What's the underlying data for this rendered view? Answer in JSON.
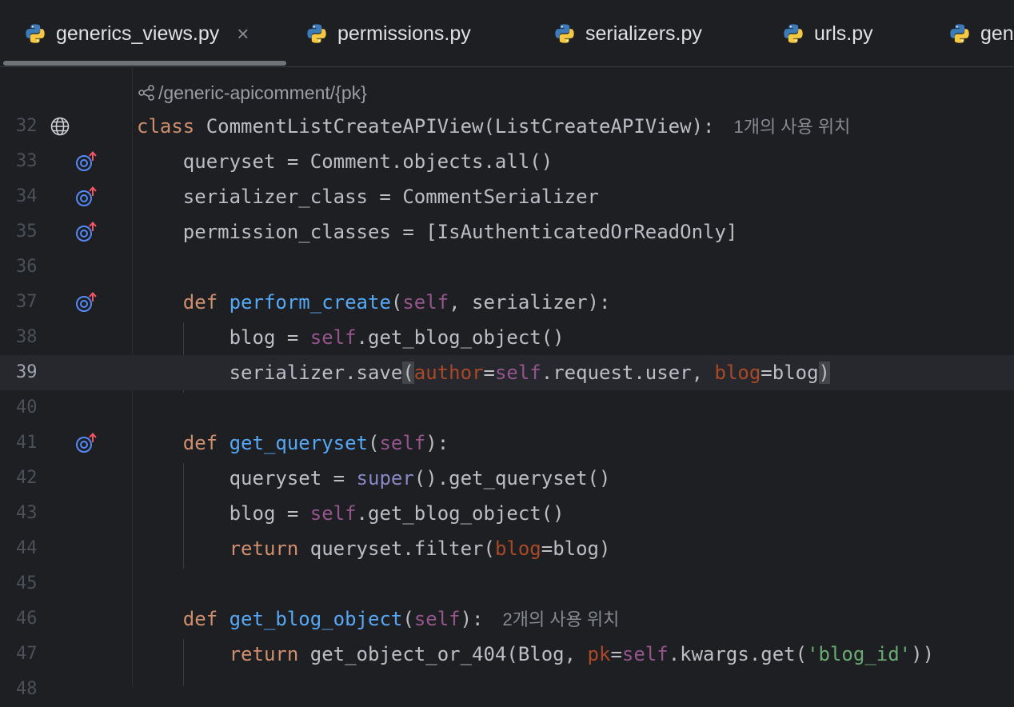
{
  "tabs": [
    {
      "label": "generics_views.py",
      "active": true,
      "closable": true
    },
    {
      "label": "permissions.py",
      "active": false
    },
    {
      "label": "serializers.py",
      "active": false
    },
    {
      "label": "urls.py",
      "active": false
    },
    {
      "label": "gen",
      "active": false
    }
  ],
  "editor": {
    "route_hint": "/generic-apicomment/{pk}",
    "current_line": 39,
    "lines": [
      {
        "num": "32"
      },
      {
        "num": "33"
      },
      {
        "num": "34"
      },
      {
        "num": "35"
      },
      {
        "num": "36"
      },
      {
        "num": "37"
      },
      {
        "num": "38"
      },
      {
        "num": "39"
      },
      {
        "num": "40"
      },
      {
        "num": "41"
      },
      {
        "num": "42"
      },
      {
        "num": "43"
      },
      {
        "num": "44"
      },
      {
        "num": "45"
      },
      {
        "num": "46"
      },
      {
        "num": "47"
      },
      {
        "num": "48"
      }
    ],
    "usage_hint_1": "1개의 사용 위치",
    "usage_hint_2": "2개의 사용 위치",
    "tokens": {
      "class_kw": "class",
      "class_name": " CommentListCreateAPIView(ListCreateAPIView):",
      "l33": "    queryset = Comment.objects.all()",
      "l34": "    serializer_class = CommentSerializer",
      "l35": "    permission_classes = [IsAuthenticatedOrReadOnly]",
      "def": "def",
      "perform_create": "perform_create",
      "get_queryset": "get_queryset",
      "get_blog_object": "get_blog_object",
      "self": "self",
      "serializer_param": ", serializer):",
      "open_paren": "(",
      "close_paren": ")",
      "close_colon": "):",
      "blog_eq": "blog = ",
      "get_blog_call": ".get_blog_object()",
      "serializer_save": "serializer.save",
      "author": "author",
      "eq": "=",
      "request_user": ".request.user, ",
      "blog_kw": "blog",
      "blog_val": "blog",
      "queryset_eq": "queryset = ",
      "super": "super",
      "super_rest": "().get_queryset()",
      "return": "return",
      "qs_filter": " queryset.filter(",
      "blog_close": "blog)",
      "get_obj": " get_object_or_404(Blog, ",
      "pk": "pk",
      "kwargs_get": ".kwargs.get(",
      "blog_id": "'blog_id'",
      "end_parens": "))"
    }
  },
  "colors": {
    "background": "#1e1f22",
    "keyword": "#cf8e6d",
    "function": "#56a8f5",
    "self": "#94558d",
    "param": "#aa4926",
    "string": "#6aab73",
    "builtin": "#8888c6",
    "text": "#bcbec4"
  }
}
